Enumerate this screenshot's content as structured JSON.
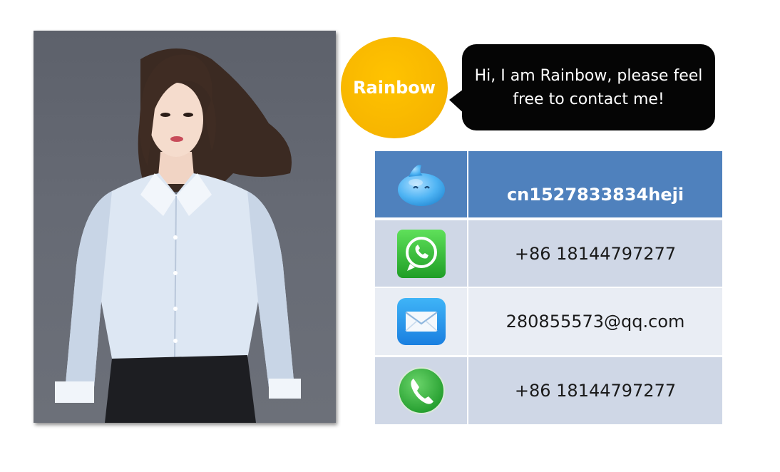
{
  "profile": {
    "name": "Rainbow",
    "greeting_line1": "Hi, I am Rainbow, please feel",
    "greeting_line2": "free to contact me!"
  },
  "contacts": [
    {
      "icon": "qq-penguin-icon",
      "value": "cn1527833834heji"
    },
    {
      "icon": "whatsapp-icon",
      "value": "+86  18144797277"
    },
    {
      "icon": "email-envelope-icon",
      "value": "280855573@qq.com"
    },
    {
      "icon": "phone-icon",
      "value": "+86  18144797277"
    }
  ],
  "colors": {
    "header_row": "#4f81bd",
    "row_dark": "#cfd7e6",
    "row_light": "#e9edf4",
    "name_circle": "#f7b500",
    "bubble": "#050505"
  }
}
